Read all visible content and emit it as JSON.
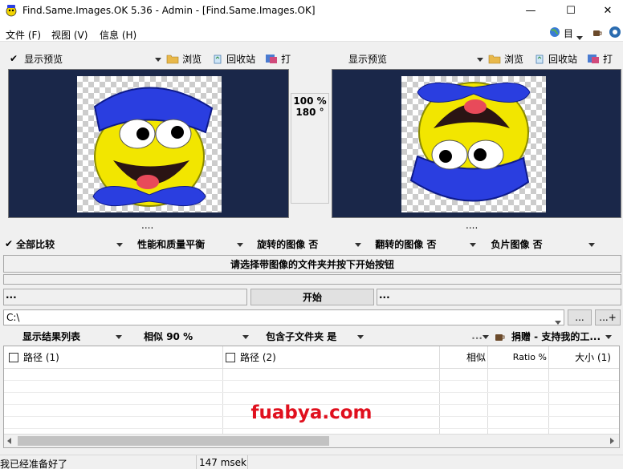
{
  "window": {
    "title": "Find.Same.Images.OK 5.36 - Admin - [Find.Same.Images.OK]",
    "minimize_glyph": "—",
    "maximize_glyph": "☐",
    "close_glyph": "✕"
  },
  "menu": {
    "items": [
      {
        "label": "文件 (F)"
      },
      {
        "label": "视图 (V)"
      },
      {
        "label": "信息 (H)"
      }
    ],
    "right_lang": "目"
  },
  "left_toolbar": {
    "check": "✔",
    "preview_label": "显示预览",
    "browse": "浏览",
    "recycle": "回收站",
    "open": "打"
  },
  "right_toolbar": {
    "preview_label": "显示预览",
    "browse": "浏览",
    "recycle": "回收站",
    "open": "打"
  },
  "compare_info": {
    "percent": "100 %",
    "angle": "180 °"
  },
  "preview_dots_left": "....",
  "preview_dots_right": "....",
  "options": {
    "check": "✔",
    "compare_all": "全部比较",
    "balance": "性能和质量平衡",
    "rotated": "旋转的图像 否",
    "flipped": "翻转的图像 否",
    "negative": "负片图像 否"
  },
  "prompt": "请选择带图像的文件夹并按下开始按钮",
  "start_row": {
    "left_dots": "...",
    "start": "开始",
    "right_dots": "..."
  },
  "path": {
    "value": "C:\\",
    "browse_btn": "...",
    "add_btn": "...+"
  },
  "result_options": {
    "list": "显示结果列表",
    "similarity": "相似 90 %",
    "subfolders": "包含子文件夹 是",
    "more": "...",
    "donate": "捐赠 - 支持我的工..."
  },
  "table": {
    "headers": {
      "path1": "路径 (1)",
      "path2": "路径 (2)",
      "similar": "相似",
      "ratio": "Ratio %",
      "size": "大小 (1)"
    },
    "scrollbar_position": 0.0,
    "scrollbar_visible_fraction": 0.53
  },
  "watermark": "fuabya.com",
  "status": {
    "message": "我已经准备好了",
    "time": "147 msek"
  },
  "colors": {
    "preview_bg": "#1a2749",
    "watermark": "#e0101e",
    "accent_blue": "#2a3ee0"
  }
}
